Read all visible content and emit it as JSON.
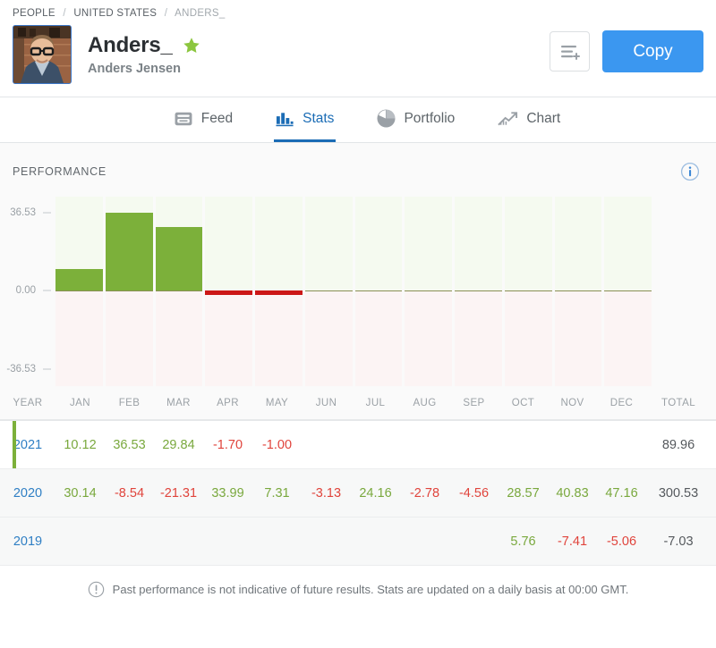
{
  "breadcrumb": {
    "items": [
      {
        "label": "PEOPLE"
      },
      {
        "label": "UNITED STATES"
      },
      {
        "label": "ANDERS_"
      }
    ],
    "separator": "/"
  },
  "profile": {
    "display_name": "Anders_",
    "real_name": "Anders Jensen",
    "avatar_alt": "avatar-photo",
    "star_color": "#8cc63f",
    "verified_icon": "star-icon"
  },
  "header_actions": {
    "list_icon": "list-add-icon",
    "copy_label": "Copy",
    "copy_color": "#3b97f0"
  },
  "tabs": [
    {
      "label": "Feed",
      "icon": "feed-icon",
      "active": false
    },
    {
      "label": "Stats",
      "icon": "bar-chart-icon",
      "active": true
    },
    {
      "label": "Portfolio",
      "icon": "pie-chart-icon",
      "active": false
    },
    {
      "label": "Chart",
      "icon": "trend-line-icon",
      "active": false
    }
  ],
  "performance": {
    "title": "PERFORMANCE",
    "info_icon": "info-icon",
    "info_color": "#3b87d6"
  },
  "chart_data": {
    "type": "bar",
    "title": "PERFORMANCE",
    "xlabel": "",
    "ylabel": "",
    "categories": [
      "JAN",
      "FEB",
      "MAR",
      "APR",
      "MAY",
      "JUN",
      "JUL",
      "AUG",
      "SEP",
      "OCT",
      "NOV",
      "DEC"
    ],
    "values": [
      10.12,
      36.53,
      29.84,
      -1.7,
      -1.0,
      null,
      null,
      null,
      null,
      null,
      null,
      null
    ],
    "ylim": [
      -36.53,
      36.53
    ],
    "yticks": [
      36.53,
      0.0,
      -36.53
    ],
    "ytick_labels": [
      "36.53",
      "0.00",
      "-36.53"
    ],
    "grid": false,
    "legend": "none",
    "positive_color": "#7cb03a",
    "negative_color": "#cc1717",
    "positive_band_color": "#f5faf0",
    "negative_band_color": "#fcf4f4"
  },
  "table": {
    "columns": [
      "YEAR",
      "JAN",
      "FEB",
      "MAR",
      "APR",
      "MAY",
      "JUN",
      "JUL",
      "AUG",
      "SEP",
      "OCT",
      "NOV",
      "DEC",
      "TOTAL"
    ],
    "rows": [
      {
        "year": "2021",
        "current": true,
        "months": [
          "10.12",
          "36.53",
          "29.84",
          "-1.70",
          "-1.00",
          "",
          "",
          "",
          "",
          "",
          "",
          "",
          ""
        ],
        "total": "89.96"
      },
      {
        "year": "2020",
        "current": false,
        "months": [
          "30.14",
          "-8.54",
          "-21.31",
          "33.99",
          "7.31",
          "-3.13",
          "24.16",
          "-2.78",
          "-4.56",
          "28.57",
          "40.83",
          "47.16"
        ],
        "total": "300.53"
      },
      {
        "year": "2019",
        "current": false,
        "months": [
          "",
          "",
          "",
          "",
          "",
          "",
          "",
          "",
          "",
          "5.76",
          "-7.41",
          "-5.06"
        ],
        "total": "-7.03"
      }
    ]
  },
  "footer": {
    "icon": "exclamation-circle-icon",
    "text": "Past performance is not indicative of future results. Stats are updated on a daily basis at 00:00 GMT."
  }
}
